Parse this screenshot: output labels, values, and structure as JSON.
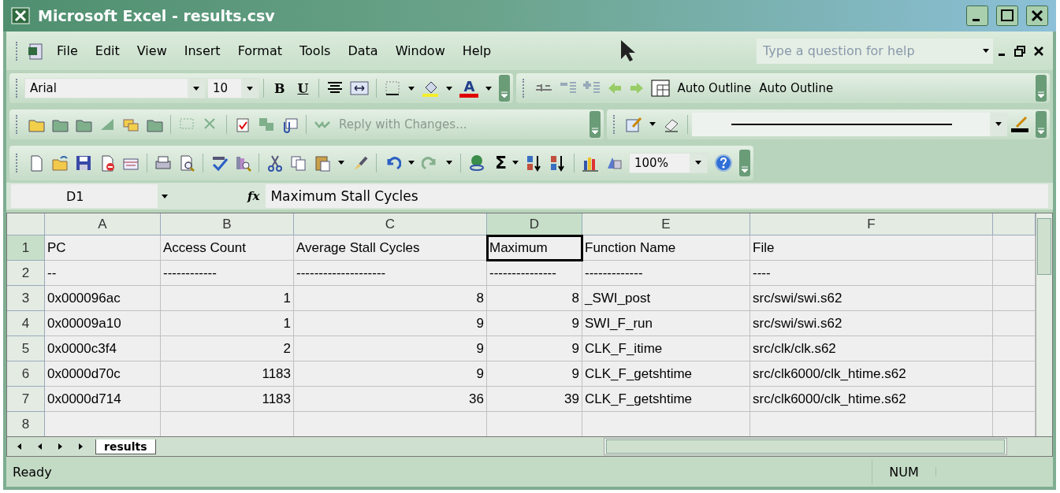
{
  "window": {
    "title": "Microsoft Excel - results.csv"
  },
  "menu_bar": {
    "items": [
      {
        "label": "File"
      },
      {
        "label": "Edit"
      },
      {
        "label": "View"
      },
      {
        "label": "Insert"
      },
      {
        "label": "Format"
      },
      {
        "label": "Tools"
      },
      {
        "label": "Data"
      },
      {
        "label": "Window"
      },
      {
        "label": "Help"
      }
    ],
    "help_box": {
      "placeholder": "Type a question for help"
    }
  },
  "formatting_toolbar": {
    "font": "Arial",
    "size": "10",
    "bold": "B",
    "underline": "U",
    "font_color": "A"
  },
  "outline_toolbar": {
    "buttons": [
      "Auto Outline",
      "Auto Outline"
    ]
  },
  "reviewing_toolbar": {
    "reply": {
      "label": "Reply with Changes...",
      "disabled": true
    }
  },
  "standard_toolbar": {
    "sum": "Σ",
    "zoom": "100%"
  },
  "formula_bar": {
    "name_box": "D1",
    "fx": "fx",
    "formula": "Maximum Stall Cycles"
  },
  "sheet": {
    "columns": [
      {
        "label": "A",
        "selected": false
      },
      {
        "label": "B",
        "selected": false
      },
      {
        "label": "C",
        "selected": false
      },
      {
        "label": "D",
        "selected": true
      },
      {
        "label": "E",
        "selected": false
      },
      {
        "label": "F",
        "selected": false
      }
    ],
    "rows": [
      {
        "label": "1",
        "selected": true,
        "cells": [
          {
            "text": "PC",
            "kind": "text"
          },
          {
            "text": "Access Count",
            "kind": "text"
          },
          {
            "text": "Average Stall Cycles",
            "kind": "text"
          },
          {
            "text": "Maximum",
            "kind": "text"
          },
          {
            "text": "Function Name",
            "kind": "text"
          },
          {
            "text": "File",
            "kind": "text"
          }
        ]
      },
      {
        "label": "2",
        "selected": false,
        "cells": [
          {
            "text": "--",
            "kind": "text"
          },
          {
            "text": "------------",
            "kind": "text"
          },
          {
            "text": "--------------------",
            "kind": "text"
          },
          {
            "text": "---------------",
            "kind": "text"
          },
          {
            "text": "-------------",
            "kind": "text"
          },
          {
            "text": "----",
            "kind": "text"
          }
        ]
      },
      {
        "label": "3",
        "selected": false,
        "cells": [
          {
            "text": "0x000096ac",
            "kind": "text"
          },
          {
            "text": "1",
            "kind": "number"
          },
          {
            "text": "8",
            "kind": "number"
          },
          {
            "text": "8",
            "kind": "number"
          },
          {
            "text": "_SWI_post",
            "kind": "text"
          },
          {
            "text": "src/swi/swi.s62",
            "kind": "text"
          }
        ]
      },
      {
        "label": "4",
        "selected": false,
        "cells": [
          {
            "text": "0x00009a10",
            "kind": "text"
          },
          {
            "text": "1",
            "kind": "number"
          },
          {
            "text": "9",
            "kind": "number"
          },
          {
            "text": "9",
            "kind": "number"
          },
          {
            "text": "SWI_F_run",
            "kind": "text"
          },
          {
            "text": "src/swi/swi.s62",
            "kind": "text"
          }
        ]
      },
      {
        "label": "5",
        "selected": false,
        "cells": [
          {
            "text": "0x0000c3f4",
            "kind": "text"
          },
          {
            "text": "2",
            "kind": "number"
          },
          {
            "text": "9",
            "kind": "number"
          },
          {
            "text": "9",
            "kind": "number"
          },
          {
            "text": "CLK_F_itime",
            "kind": "text"
          },
          {
            "text": "src/clk/clk.s62",
            "kind": "text"
          }
        ]
      },
      {
        "label": "6",
        "selected": false,
        "cells": [
          {
            "text": "0x0000d70c",
            "kind": "text"
          },
          {
            "text": "1183",
            "kind": "number"
          },
          {
            "text": "9",
            "kind": "number"
          },
          {
            "text": "9",
            "kind": "number"
          },
          {
            "text": "CLK_F_getshtime",
            "kind": "text"
          },
          {
            "text": "src/clk6000/clk_htime.s62",
            "kind": "text"
          }
        ]
      },
      {
        "label": "7",
        "selected": false,
        "cells": [
          {
            "text": "0x0000d714",
            "kind": "text"
          },
          {
            "text": "1183",
            "kind": "number"
          },
          {
            "text": "36",
            "kind": "number"
          },
          {
            "text": "39",
            "kind": "number"
          },
          {
            "text": "CLK_F_getshtime",
            "kind": "text"
          },
          {
            "text": "src/clk6000/clk_htime.s62",
            "kind": "text"
          }
        ]
      },
      {
        "label": "8",
        "selected": false,
        "cells": []
      }
    ],
    "tabs": [
      {
        "label": "results",
        "selected": true
      }
    ]
  },
  "status_bar": {
    "status": "Ready",
    "indicators": [
      "NUM"
    ]
  }
}
